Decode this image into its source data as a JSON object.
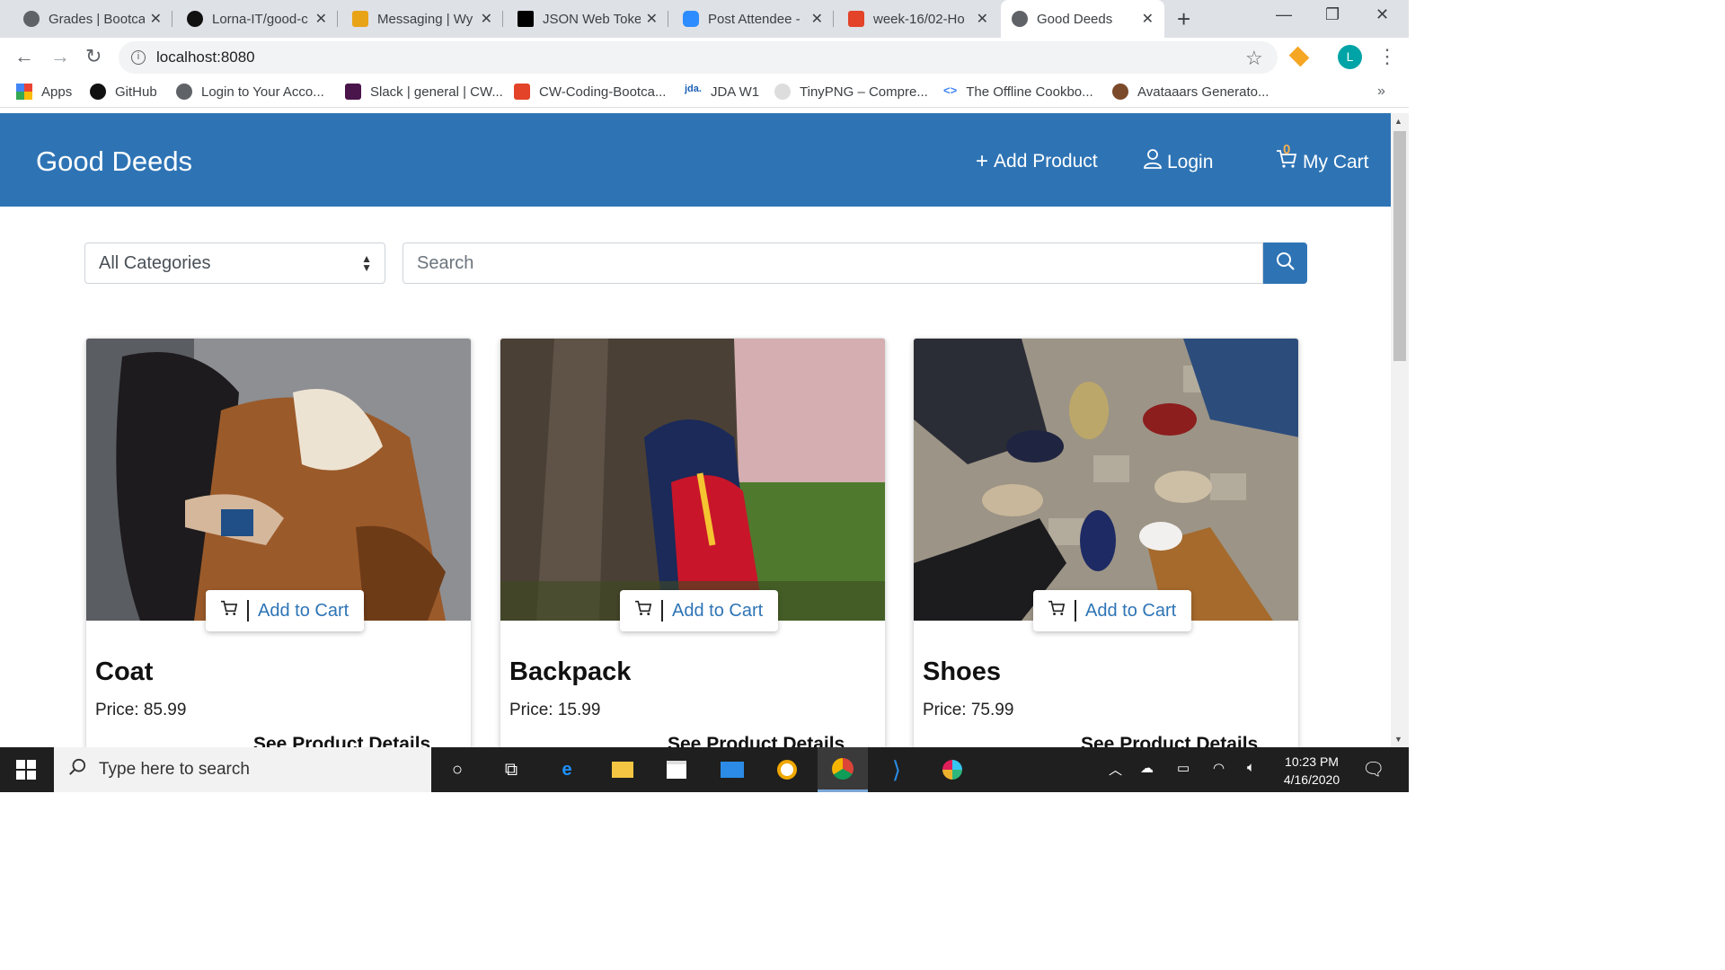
{
  "browser": {
    "tabs": [
      {
        "label": "Grades | Bootca",
        "icon": "globe-icon"
      },
      {
        "label": "Lorna-IT/good-c",
        "icon": "github-icon"
      },
      {
        "label": "Messaging | Wy",
        "icon": "messaging-icon"
      },
      {
        "label": "JSON Web Toke",
        "icon": "jwt-icon"
      },
      {
        "label": "Post Attendee -",
        "icon": "zoom-icon"
      },
      {
        "label": "week-16/02-Ho",
        "icon": "gitlab-icon"
      },
      {
        "label": "Good Deeds",
        "icon": "globe-icon"
      }
    ],
    "url": "localhost:8080",
    "avatar_letter": "L",
    "bookmarks": [
      {
        "label": "Apps"
      },
      {
        "label": "GitHub"
      },
      {
        "label": "Login to Your Acco..."
      },
      {
        "label": "Slack | general | CW..."
      },
      {
        "label": "CW-Coding-Bootca..."
      },
      {
        "label": "JDA W1"
      },
      {
        "label": "TinyPNG – Compre..."
      },
      {
        "label": "The Offline Cookbo..."
      },
      {
        "label": "Avataaars Generato..."
      }
    ]
  },
  "site": {
    "brand": "Good Deeds",
    "nav": {
      "add_product": "Add Product",
      "login": "Login",
      "cart": "My Cart",
      "cart_count": "0"
    },
    "filters": {
      "category": "All Categories",
      "search_placeholder": "Search"
    },
    "products": [
      {
        "name": "Coat",
        "price": "Price: 85.99",
        "add_label": "Add to Cart",
        "details_label": "See Product Details"
      },
      {
        "name": "Backpack",
        "price": "Price: 15.99",
        "add_label": "Add to Cart",
        "details_label": "See Product Details"
      },
      {
        "name": "Shoes",
        "price": "Price: 75.99",
        "add_label": "Add to Cart",
        "details_label": "See Product Details"
      }
    ],
    "colors": {
      "primary": "#2e74b5",
      "badge": "#f0ad4e"
    }
  },
  "taskbar": {
    "search_placeholder": "Type here to search",
    "time": "10:23 PM",
    "date": "4/16/2020"
  }
}
